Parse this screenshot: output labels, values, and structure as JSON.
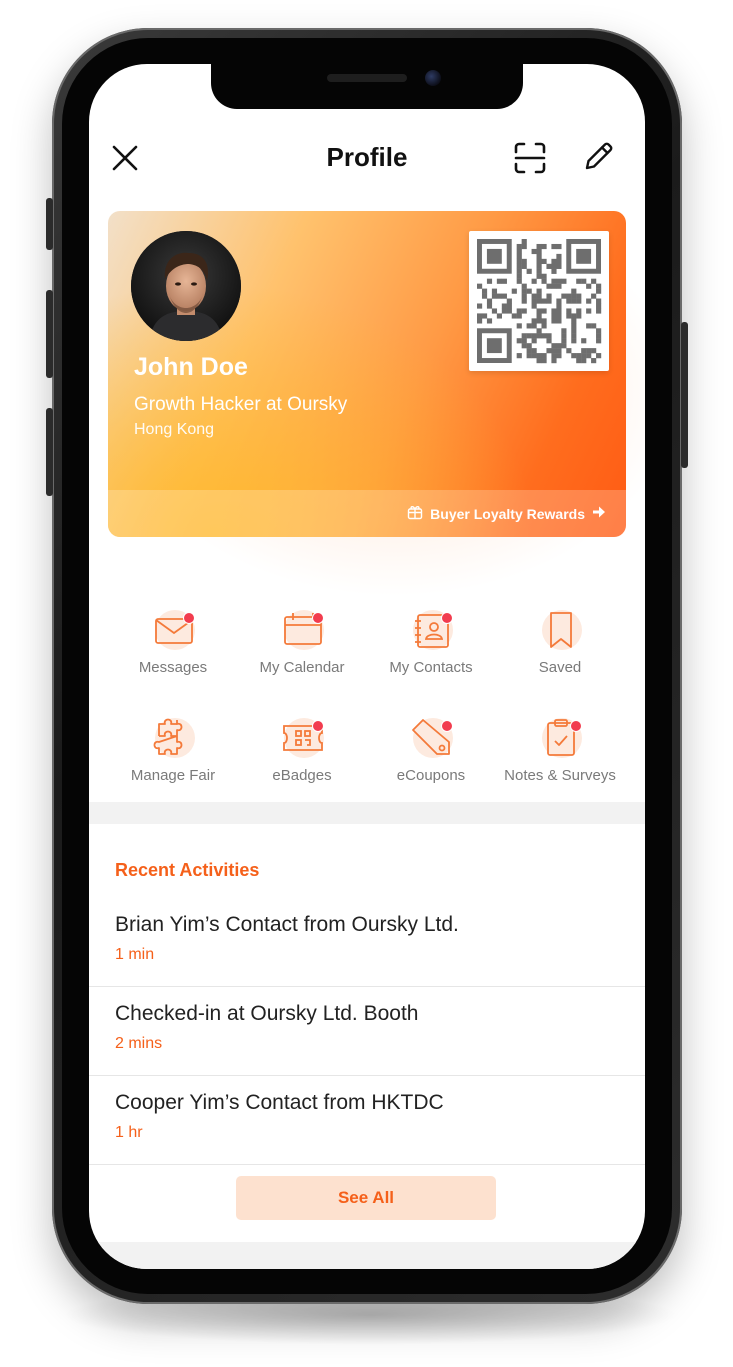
{
  "header": {
    "title": "Profile"
  },
  "icons": {
    "close": "close-icon",
    "scan": "scan-icon",
    "edit": "pencil-icon",
    "rewards": "gift-icon",
    "rewards_arrow": "arrow-right-icon"
  },
  "card": {
    "name": "John Doe",
    "job_title": "Growth Hacker at Oursky",
    "location": "Hong Kong",
    "rewards_label": "Buyer Loyalty Rewards"
  },
  "menu": [
    {
      "label": "Messages",
      "icon": "envelope-icon",
      "badge": true
    },
    {
      "label": "My Calendar",
      "icon": "calendar-icon",
      "badge": true
    },
    {
      "label": "My Contacts",
      "icon": "contact-book-icon",
      "badge": true
    },
    {
      "label": "Saved",
      "icon": "bookmark-icon",
      "badge": false
    },
    {
      "label": "Manage Fair",
      "icon": "puzzle-icon",
      "badge": false
    },
    {
      "label": "eBadges",
      "icon": "ticket-qr-icon",
      "badge": true
    },
    {
      "label": "eCoupons",
      "icon": "tag-icon",
      "badge": true
    },
    {
      "label": "Notes & Surveys",
      "icon": "clipboard-check-icon",
      "badge": true
    }
  ],
  "recent": {
    "title": "Recent Activities",
    "items": [
      {
        "text": "Brian Yim’s Contact from Oursky Ltd.",
        "time": "1 min"
      },
      {
        "text": "Checked-in at Oursky Ltd. Booth",
        "time": "2 mins"
      },
      {
        "text": "Cooper Yim’s Contact from HKTDC",
        "time": "1 hr"
      }
    ],
    "see_all": "See All"
  },
  "colors": {
    "accent": "#f5601a",
    "badge": "#f23c4e",
    "icon_bg": "#fdeadf",
    "see_all_bg": "#fde1cf"
  }
}
